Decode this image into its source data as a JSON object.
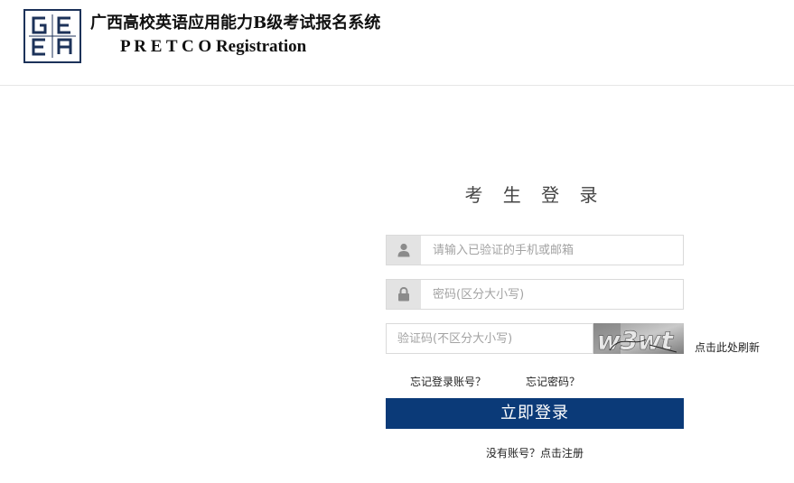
{
  "header": {
    "logo_letters": "GEEA",
    "title_cn": "广西高校英语应用能力B级考试报名系统",
    "title_en": "P R E T C O Registration"
  },
  "login": {
    "title": "考 生 登 录",
    "username_placeholder": "请输入已验证的手机或邮箱",
    "password_placeholder": "密码(区分大小写)",
    "captcha_placeholder": "验证码(不区分大小写)",
    "captcha_text": "w3wt",
    "refresh_label": "点击此处刷新",
    "forgot_account": "忘记登录账号？",
    "forgot_password": "忘记密码？",
    "submit_label": "立即登录",
    "register_prompt": "没有账号？点击注册"
  },
  "colors": {
    "primary": "#0b3a78",
    "logo": "#1c3259",
    "icon_bg": "#e3e3e3"
  },
  "icons": [
    "user-icon",
    "lock-icon"
  ]
}
